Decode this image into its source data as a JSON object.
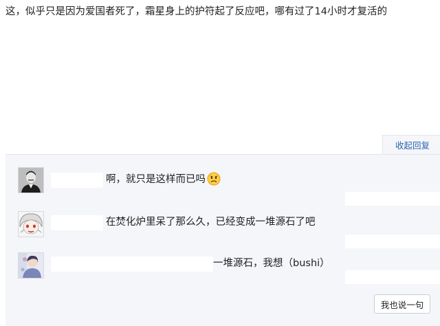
{
  "post": {
    "text": "这，似乎只是因为爱国者死了，霜星身上的护符起了反应吧，哪有过了14小时才复活的"
  },
  "replies_panel": {
    "collapse_label": "收起回复",
    "reply_button_label": "我也说一句",
    "replies": [
      {
        "avatar": "portrait-photo-avatar",
        "text": "啊，就只是这样而已吗",
        "emoji": "frowning-face-emoji"
      },
      {
        "avatar": "anime-character-avatar",
        "text": "在焚化炉里呆了那么久，已经变成一堆源石了吧"
      },
      {
        "avatar": "illustration-avatar",
        "text": "一堆源石，我想（bushi）"
      }
    ]
  }
}
